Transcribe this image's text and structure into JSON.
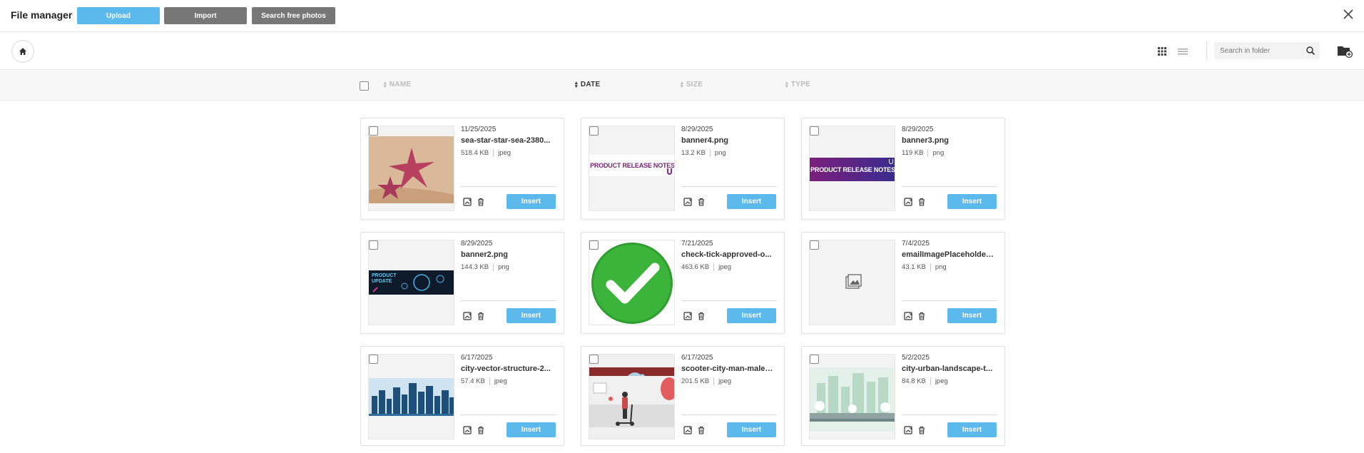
{
  "header": {
    "title": "File manager",
    "upload_label": "Upload",
    "import_label": "Import",
    "search_photos_label": "Search free photos"
  },
  "toolbar": {
    "search_placeholder": "Search in folder"
  },
  "columns": {
    "name": "NAME",
    "date": "DATE",
    "size": "SIZE",
    "type": "TYPE"
  },
  "colors": {
    "accent": "#5bb9ec",
    "secondary_button": "#777777"
  },
  "files": [
    {
      "date": "11/25/2025",
      "name": "sea-star-star-sea-2380...",
      "size": "518.4 KB",
      "type": "jpeg",
      "insert_label": "Insert",
      "thumb": "starfish"
    },
    {
      "date": "8/29/2025",
      "name": "banner4.png",
      "size": "13.2 KB",
      "type": "png",
      "insert_label": "Insert",
      "thumb": "banner-white",
      "thumb_text": "PRODUCT RELEASE NOTES"
    },
    {
      "date": "8/29/2025",
      "name": "banner3.png",
      "size": "119 KB",
      "type": "png",
      "insert_label": "Insert",
      "thumb": "banner-purple",
      "thumb_text": "PRODUCT RELEASE NOTES"
    },
    {
      "date": "8/29/2025",
      "name": "banner2.png",
      "size": "144.3 KB",
      "type": "png",
      "insert_label": "Insert",
      "thumb": "banner-dark",
      "thumb_text": "PRODUCT UPDATE"
    },
    {
      "date": "7/21/2025",
      "name": "check-tick-approved-o...",
      "size": "463.6 KB",
      "type": "jpeg",
      "insert_label": "Insert",
      "thumb": "check"
    },
    {
      "date": "7/4/2025",
      "name": "emailImagePlaceholder...",
      "size": "43.1 KB",
      "type": "png",
      "insert_label": "Insert",
      "thumb": "placeholder"
    },
    {
      "date": "6/17/2025",
      "name": "city-vector-structure-2...",
      "size": "57.4 KB",
      "type": "jpeg",
      "insert_label": "Insert",
      "thumb": "city-blue"
    },
    {
      "date": "6/17/2025",
      "name": "scooter-city-man-male-...",
      "size": "201.5 KB",
      "type": "jpeg",
      "insert_label": "Insert",
      "thumb": "scooter"
    },
    {
      "date": "5/2/2025",
      "name": "city-urban-landscape-t...",
      "size": "84.8 KB",
      "type": "jpeg",
      "insert_label": "Insert",
      "thumb": "city-green"
    }
  ]
}
